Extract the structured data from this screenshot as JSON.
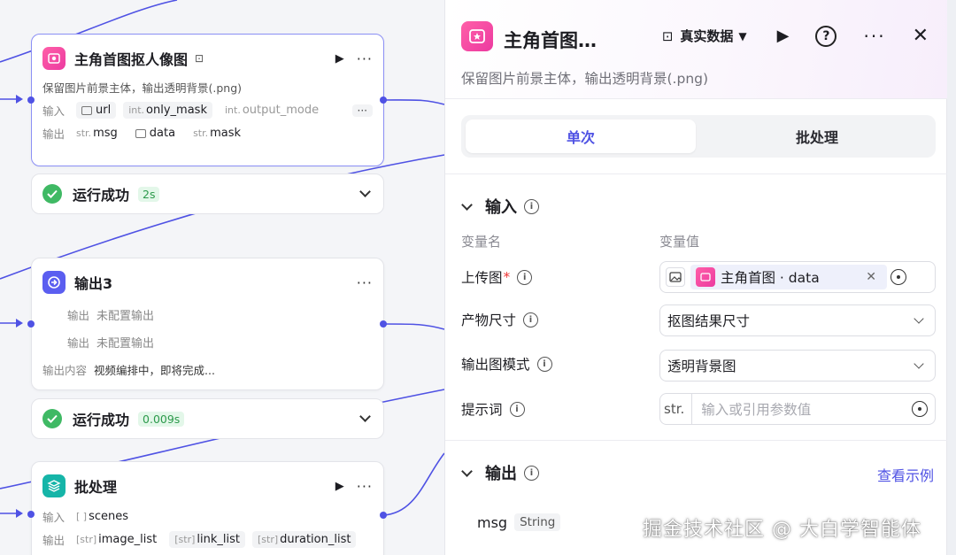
{
  "nodes": {
    "matting": {
      "title": "主角首图抠人像图",
      "description": "保留图片前景主体，输出透明背景(.png)",
      "input_label": "输入",
      "output_label": "输出",
      "inputs": [
        {
          "type": "img",
          "name": "url"
        },
        {
          "type": "int.",
          "name": "only_mask"
        },
        {
          "type": "int.",
          "name": "output_mode"
        }
      ],
      "outputs": [
        {
          "type": "str.",
          "name": "msg"
        },
        {
          "type": "img",
          "name": "data"
        },
        {
          "type": "str.",
          "name": "mask"
        }
      ],
      "more": "···"
    },
    "matting_status": {
      "text": "运行成功",
      "time": "2s"
    },
    "output3": {
      "title": "输出3",
      "rows": [
        {
          "label": "输出",
          "value": "未配置输出"
        },
        {
          "label": "输出",
          "value": "未配置输出"
        }
      ],
      "content_label": "输出内容",
      "content_value": "视频编排中，即将完成..."
    },
    "output3_status": {
      "text": "运行成功",
      "time": "0.009s"
    },
    "batch": {
      "title": "批处理",
      "input_label": "输入",
      "output_label": "输出",
      "inputs": [
        {
          "type": "[ ]",
          "name": "scenes"
        }
      ],
      "outputs": [
        {
          "type": "[str]",
          "name": "image_list"
        },
        {
          "type": "[str]",
          "name": "link_list"
        },
        {
          "type": "[str]",
          "name": "duration_list"
        }
      ]
    }
  },
  "panel": {
    "title": "主角首图…",
    "data_source": "真实数据",
    "description": "保留图片前景主体，输出透明背景(.png)",
    "tabs": {
      "single": "单次",
      "batch": "批处理"
    },
    "input_section": "输入",
    "col_name": "变量名",
    "col_value": "变量值",
    "fields": {
      "upload": {
        "label": "上传图",
        "required": "*",
        "ref": "主角首图 · data"
      },
      "size": {
        "label": "产物尺寸",
        "value": "抠图结果尺寸"
      },
      "mode": {
        "label": "输出图模式",
        "value": "透明背景图"
      },
      "prompt": {
        "label": "提示词",
        "tag": "str.",
        "placeholder": "输入或引用参数值"
      }
    },
    "output_section": "输出",
    "see_example": "查看示例",
    "output_var": {
      "name": "msg",
      "type": "String"
    }
  },
  "watermark": "掘金技术社区 @ 大白学智能体",
  "colors": {
    "accent": "#4f52e4",
    "success": "#3fb964",
    "pink": "#ec3aa0",
    "teal": "#16b5a8"
  }
}
